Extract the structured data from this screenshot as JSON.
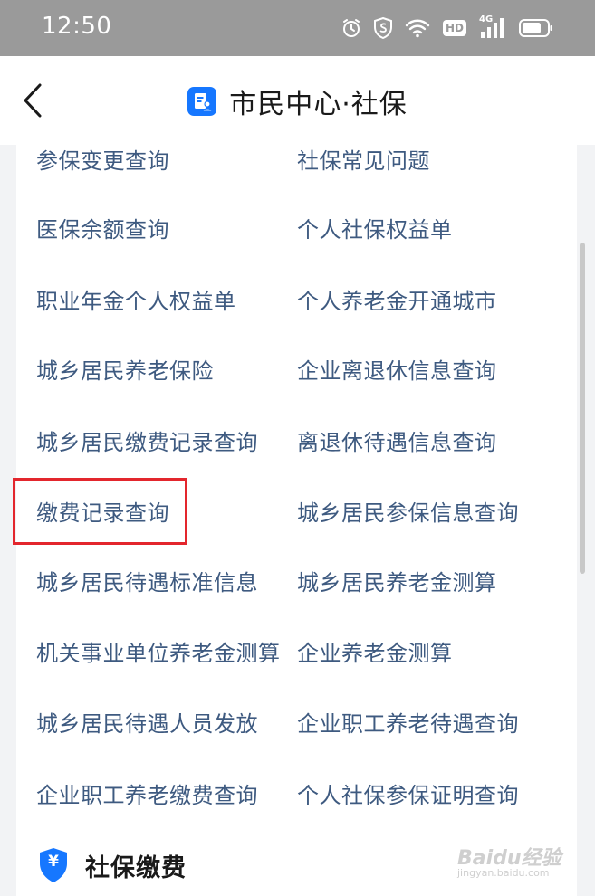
{
  "status_bar": {
    "time": "12:50",
    "icons": [
      "alarm-icon",
      "shield-icon",
      "wifi-icon",
      "hd-icon",
      "signal-4g-icon",
      "battery-icon"
    ],
    "hd_label": "HD",
    "network_label": "4G"
  },
  "nav": {
    "back_icon": "chevron-left-icon",
    "title": "市民中心·社保",
    "title_icon": "document-user-icon"
  },
  "services": {
    "left": [
      "参保变更查询",
      "医保余额查询",
      "职业年金个人权益单",
      "城乡居民养老保险",
      "城乡居民缴费记录查询",
      "缴费记录查询",
      "城乡居民待遇标准信息",
      "机关事业单位养老金测算",
      "城乡居民待遇人员发放",
      "企业职工养老缴费查询"
    ],
    "right": [
      "社保常见问题",
      "个人社保权益单",
      "个人养老金开通城市",
      "企业离退休信息查询",
      "离退休待遇信息查询",
      "城乡居民参保信息查询",
      "城乡居民养老金测算",
      "企业养老金测算",
      "企业职工养老待遇查询",
      "个人社保参保证明查询"
    ],
    "highlighted": "缴费记录查询"
  },
  "section": {
    "title": "社保缴费",
    "icon": "yuan-shield-icon",
    "icon_symbol": "¥"
  },
  "watermark": {
    "brand": "Baidu经验",
    "url": "jingyan.baidu.com"
  },
  "colors": {
    "link": "#3e5a80",
    "accent": "#1677ff",
    "highlight": "#e3262d",
    "status_bar": "#9a9a9a"
  }
}
